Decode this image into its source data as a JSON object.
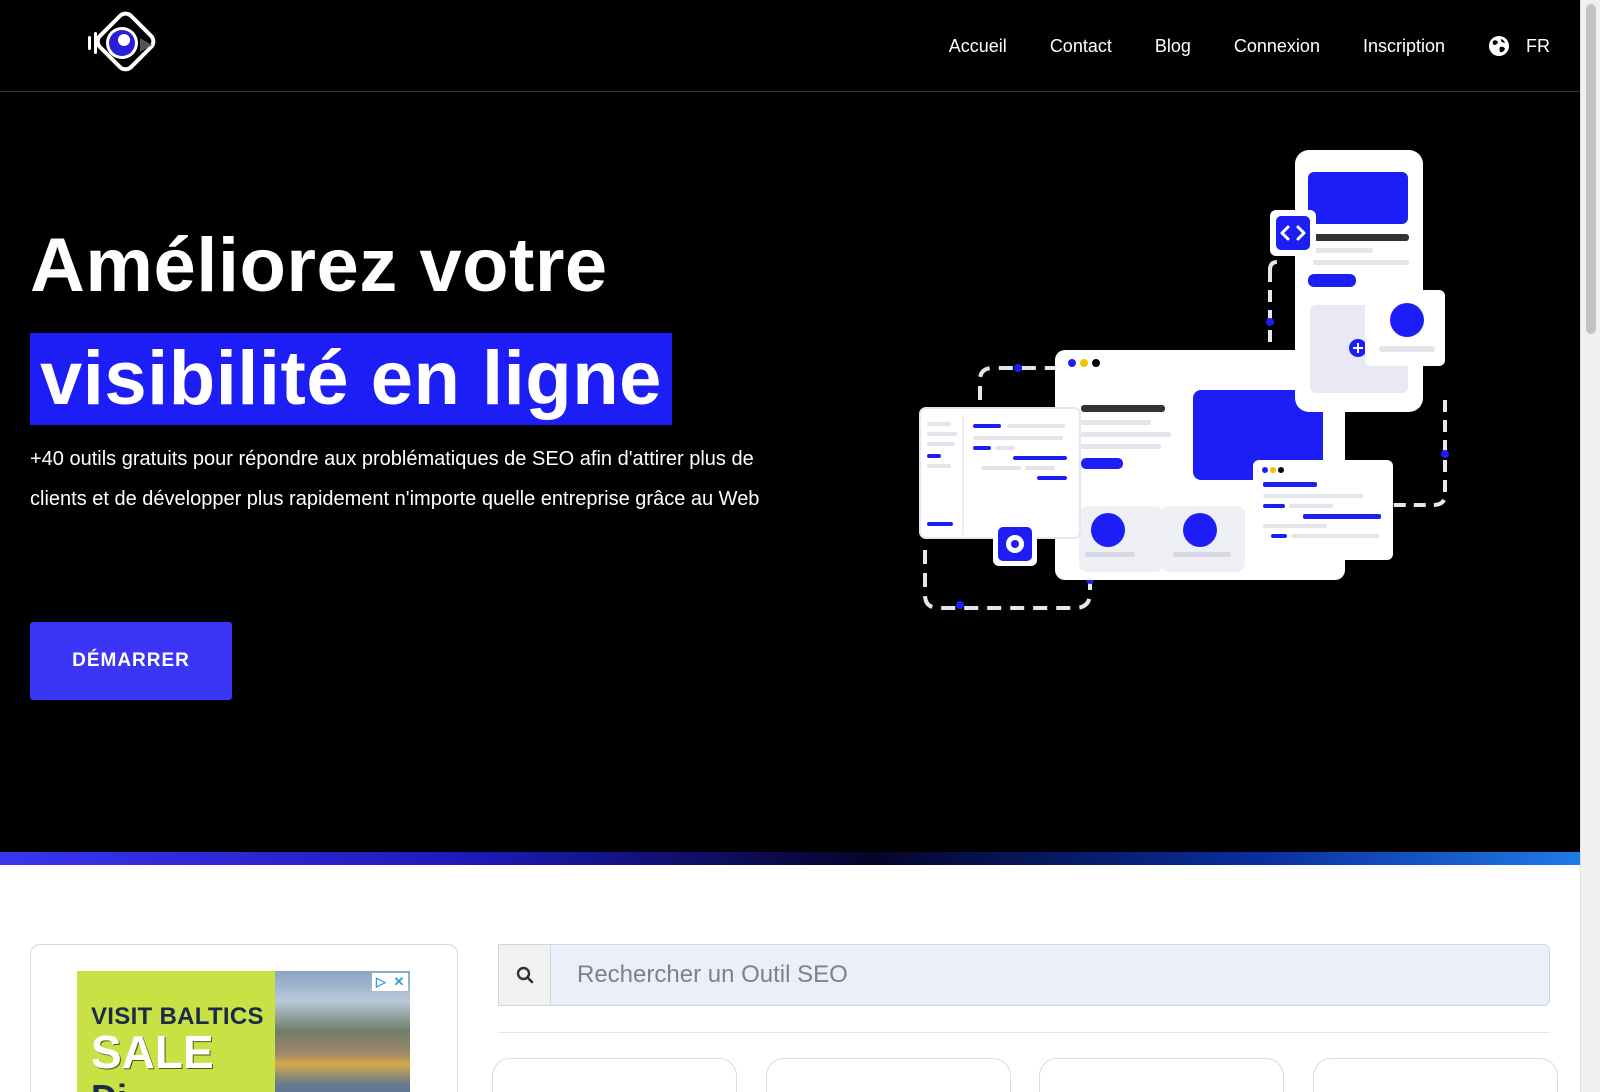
{
  "header": {
    "nav": [
      {
        "label": "Accueil"
      },
      {
        "label": "Contact"
      },
      {
        "label": "Blog"
      },
      {
        "label": "Connexion"
      },
      {
        "label": "Inscription"
      }
    ],
    "language": "FR"
  },
  "hero": {
    "title_line_1": "Améliorez votre",
    "title_line_2": "visibilité en ligne",
    "description": "+40 outils gratuits pour répondre aux problématiques de SEO afin d'attirer plus de clients et de développer plus rapidement n'importe quelle entreprise grâce au Web",
    "cta_label": "DÉMARRER"
  },
  "ad": {
    "line_1": "VISIT BALTICS",
    "line_2": "SALE",
    "line_3": "Di"
  },
  "search": {
    "placeholder": "Rechercher un Outil SEO"
  },
  "colors": {
    "accent": "#1d1ef5",
    "button": "#3b35f5",
    "background_dark": "#000000"
  }
}
